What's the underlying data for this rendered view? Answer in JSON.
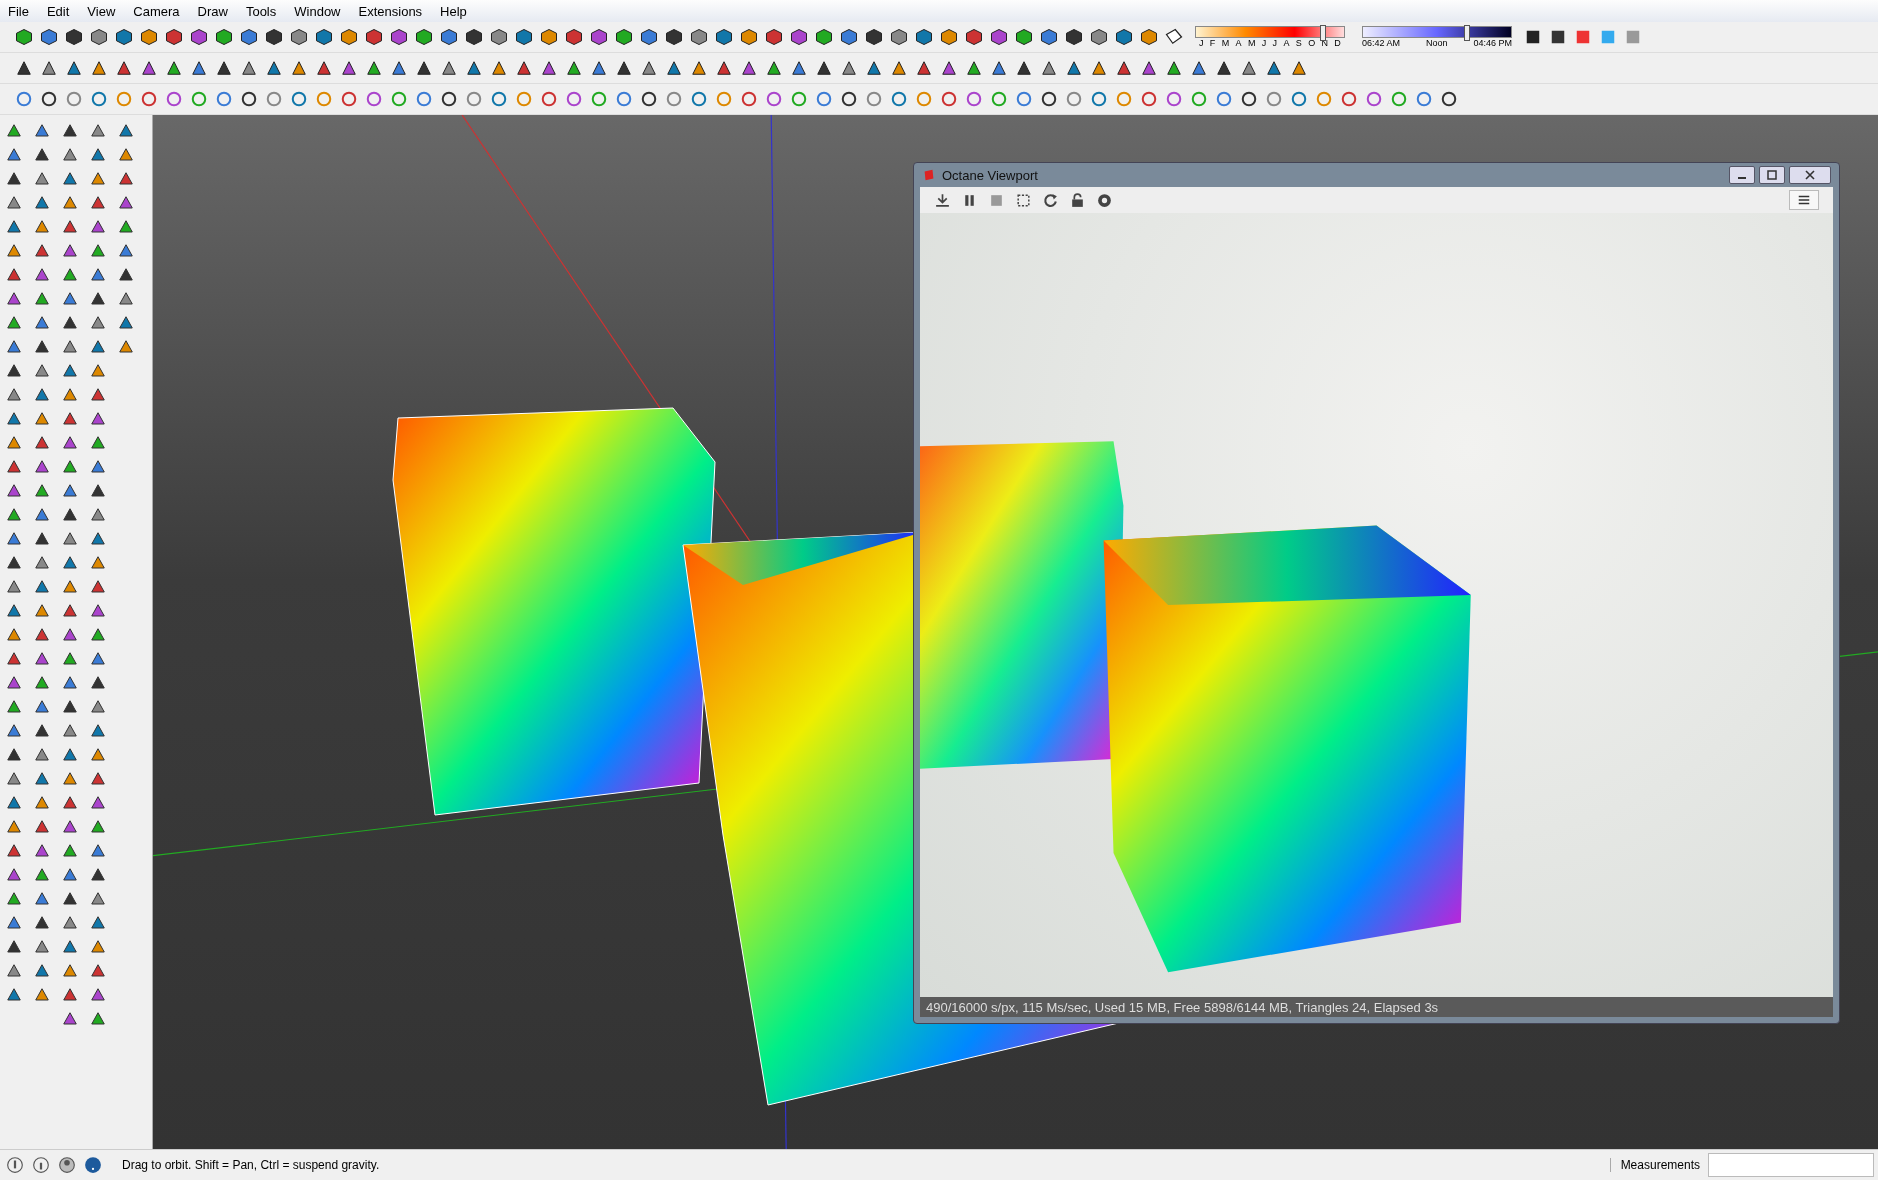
{
  "menu": [
    "File",
    "Edit",
    "View",
    "Camera",
    "Draw",
    "Tools",
    "Window",
    "Extensions",
    "Help"
  ],
  "shadow_settings": {
    "months": [
      "J",
      "F",
      "M",
      "A",
      "M",
      "J",
      "J",
      "A",
      "S",
      "O",
      "N",
      "D"
    ],
    "month_slider": {
      "level": 0.86
    },
    "time_labels": [
      "06:42 AM",
      "Noon",
      "04:46 PM"
    ],
    "time_slider": {
      "level": 0.7
    }
  },
  "octane_viewport": {
    "title": "Octane Viewport",
    "status": "490/16000 s/px, 115 Ms/sec, Used 15 MB, Free 5898/6144 MB, Triangles 24, Elapsed 3s"
  },
  "status_bar": {
    "hint": "Drag to orbit. Shift = Pan, Ctrl = suspend gravity.",
    "measurements_label": "Measurements"
  }
}
